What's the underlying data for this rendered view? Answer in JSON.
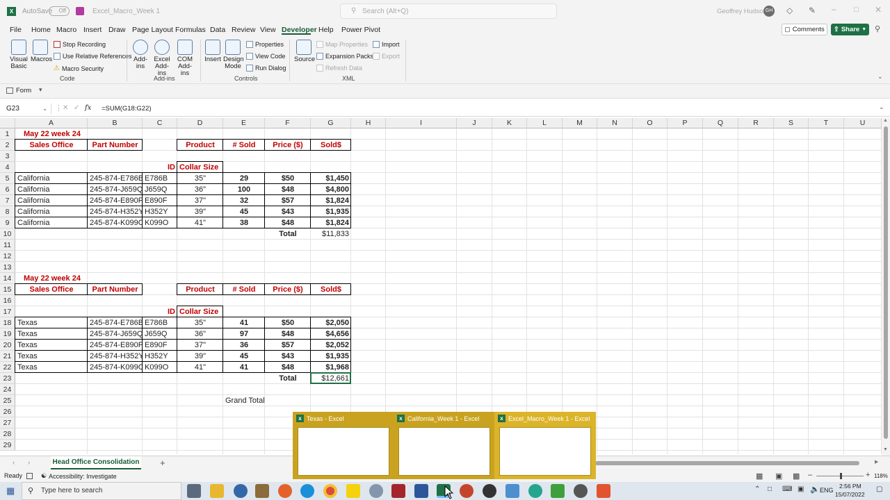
{
  "titlebar": {
    "autosave_label": "AutoSave",
    "autosave_state": "Off",
    "filename": "Excel_Macro_Week 1",
    "search_placeholder": "Search (Alt+Q)",
    "user_name": "Geoffrey Hudson",
    "user_initials": "GH"
  },
  "menu": {
    "tabs": [
      "File",
      "Home",
      "Macro",
      "Insert",
      "Draw",
      "Page Layout",
      "Formulas",
      "Data",
      "Review",
      "View",
      "Developer",
      "Help",
      "Power Pivot"
    ],
    "active": "Developer",
    "comments_label": "Comments",
    "share_label": "Share"
  },
  "ribbon": {
    "code": {
      "visual_basic": "Visual Basic",
      "macros": "Macros",
      "stop_recording": "Stop Recording",
      "relative_refs": "Use Relative References",
      "macro_security": "Macro Security",
      "group": "Code"
    },
    "addins": {
      "addins": "Add-ins",
      "excel_addins": "Excel Add-ins",
      "com_addins": "COM Add-ins",
      "group": "Add-ins"
    },
    "controls": {
      "insert": "Insert",
      "design_mode": "Design Mode",
      "properties": "Properties",
      "view_code": "View Code",
      "run_dialog": "Run Dialog",
      "group": "Controls"
    },
    "xml": {
      "source": "Source",
      "map_properties": "Map Properties",
      "expansion_packs": "Expansion Packs",
      "refresh_data": "Refresh Data",
      "import": "Import",
      "export": "Export",
      "group": "XML"
    }
  },
  "quick": {
    "form_label": "Form"
  },
  "formula": {
    "name_box": "G23",
    "fx": "fx",
    "formula": "=SUM(G18:G22)"
  },
  "grid": {
    "columns": [
      "A",
      "B",
      "C",
      "D",
      "E",
      "F",
      "G",
      "H",
      "I",
      "J",
      "K",
      "L",
      "M",
      "N",
      "O",
      "P",
      "Q",
      "R",
      "S",
      "T",
      "U"
    ],
    "rows": [
      "1",
      "2",
      "3",
      "4",
      "5",
      "6",
      "7",
      "8",
      "9",
      "10",
      "11",
      "12",
      "13",
      "14",
      "15",
      "16",
      "17",
      "18",
      "19",
      "20",
      "21",
      "22",
      "23",
      "24",
      "25",
      "26",
      "27",
      "28",
      "29"
    ],
    "blocks": [
      {
        "heading": "May 22 week 24",
        "sales_office": "Sales Office",
        "part_number": "Part Number",
        "product": "Product",
        "sold": "# Sold",
        "price": "Price ($)",
        "solds": "Sold$",
        "id": "ID",
        "collar": "Collar Size",
        "rows": [
          {
            "office": "California",
            "part": "245-874-E786B",
            "id": "E786B",
            "size": "35\"",
            "sold": "29",
            "price": "$50",
            "total": "$1,450"
          },
          {
            "office": "California",
            "part": "245-874-J659Q",
            "id": "J659Q",
            "size": "36\"",
            "sold": "100",
            "price": "$48",
            "total": "$4,800"
          },
          {
            "office": "California",
            "part": "245-874-E890F",
            "id": "E890F",
            "size": "37\"",
            "sold": "32",
            "price": "$57",
            "total": "$1,824"
          },
          {
            "office": "California",
            "part": "245-874-H352Y",
            "id": "H352Y",
            "size": "39\"",
            "sold": "45",
            "price": "$43",
            "total": "$1,935"
          },
          {
            "office": "California",
            "part": "245-874-K099O",
            "id": "K099O",
            "size": "41\"",
            "sold": "38",
            "price": "$48",
            "total": "$1,824"
          }
        ],
        "total_label": "Total",
        "total_value": "$11,833"
      },
      {
        "heading": "May 22 week 24",
        "sales_office": "Sales Office",
        "part_number": "Part Number",
        "product": "Product",
        "sold": "# Sold",
        "price": "Price ($)",
        "solds": "Sold$",
        "id": "ID",
        "collar": "Collar Size",
        "rows": [
          {
            "office": "Texas",
            "part": "245-874-E786B",
            "id": "E786B",
            "size": "35\"",
            "sold": "41",
            "price": "$50",
            "total": "$2,050"
          },
          {
            "office": "Texas",
            "part": "245-874-J659Q",
            "id": "J659Q",
            "size": "36\"",
            "sold": "97",
            "price": "$48",
            "total": "$4,656"
          },
          {
            "office": "Texas",
            "part": "245-874-E890F",
            "id": "E890F",
            "size": "37\"",
            "sold": "36",
            "price": "$57",
            "total": "$2,052"
          },
          {
            "office": "Texas",
            "part": "245-874-H352Y",
            "id": "H352Y",
            "size": "39\"",
            "sold": "45",
            "price": "$43",
            "total": "$1,935"
          },
          {
            "office": "Texas",
            "part": "245-874-K099O",
            "id": "K099O",
            "size": "41\"",
            "sold": "41",
            "price": "$48",
            "total": "$1,968"
          }
        ],
        "total_label": "Total",
        "total_value": "$12,661"
      }
    ],
    "grand_total_label": "Grand Total"
  },
  "sheets": {
    "active": "Head Office Consolidation",
    "add": "+"
  },
  "status": {
    "ready": "Ready",
    "accessibility": "Accessibility: Investigate",
    "zoom": "118%"
  },
  "taskbar": {
    "search_placeholder": "Type here to search",
    "lang": "ENG",
    "time": "2:56 PM",
    "date": "15/07/2022"
  },
  "popup": {
    "items": [
      "Texas - Excel",
      "California_Week 1 - Excel",
      "Excel_Macro_Week 1 - Excel"
    ]
  },
  "colors": {
    "accent": "#185c37",
    "header_red": "#c00000",
    "popup_bg": "#c9a320"
  }
}
